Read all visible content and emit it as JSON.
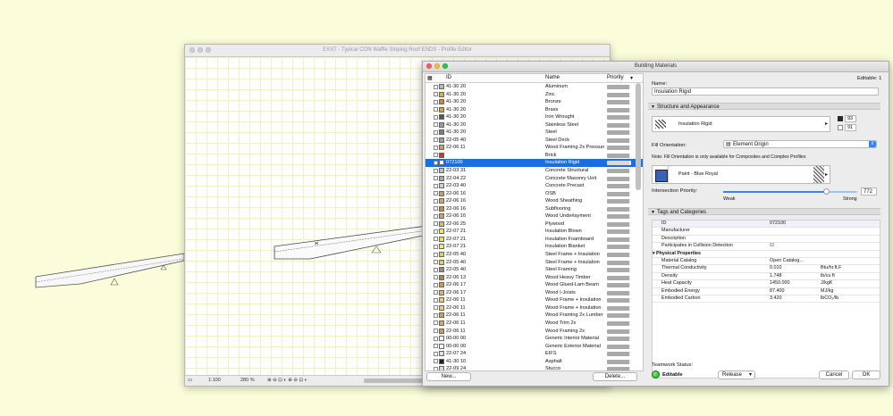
{
  "profile_editor": {
    "title": "EXST - Typical CON Waffle Sloping Roof ENDS - Profile Editor",
    "scale": "1:100",
    "zoom": "280 %"
  },
  "dialog": {
    "title": "Building Materials",
    "editable_label": "Editable: 1",
    "list_headers": {
      "id": "ID",
      "name": "Name",
      "priority": "Priority"
    },
    "rows": [
      {
        "id": "41-30 20",
        "name": "Aluminum",
        "swatch": "#b8b8b8"
      },
      {
        "id": "41-30 20",
        "name": "Zinc",
        "swatch": "#d7b24a"
      },
      {
        "id": "41-30 20",
        "name": "Bronze",
        "swatch": "#c58b3a"
      },
      {
        "id": "41-30 20",
        "name": "Brass",
        "swatch": "#e2a12b"
      },
      {
        "id": "41-30 20",
        "name": "Iron Wrought",
        "swatch": "#555555"
      },
      {
        "id": "41-30 20",
        "name": "Stainless Steel",
        "swatch": "#999999"
      },
      {
        "id": "41-30 20",
        "name": "Steel",
        "swatch": "#7d7d7d"
      },
      {
        "id": "22-05 40",
        "name": "Steel Deck",
        "swatch": "#9e9e9e"
      },
      {
        "id": "22-06 11",
        "name": "Wood Framing 2x Pressure",
        "swatch": "#c9a062"
      },
      {
        "id": "",
        "name": "Brick",
        "swatch": "#c0392b"
      },
      {
        "id": "072100",
        "name": "Insulation Rigid",
        "swatch": "#ffffff"
      },
      {
        "id": "22-03 31",
        "name": "Concrete Structural",
        "swatch": "#bdbdbd"
      },
      {
        "id": "22-04 22",
        "name": "Concrete Masonry Unit",
        "swatch": "#a5a5a5"
      },
      {
        "id": "22-03 40",
        "name": "Concrete Precast",
        "swatch": "#cfcfcf"
      },
      {
        "id": "22-06 16",
        "name": "OSB",
        "swatch": "#c7a15a"
      },
      {
        "id": "22-06 16",
        "name": "Wood Sheathing",
        "swatch": "#d1a866"
      },
      {
        "id": "22-06 16",
        "name": "Subflooring",
        "swatch": "#b88f4e"
      },
      {
        "id": "22-06 16",
        "name": "Wood Underlayment",
        "swatch": "#caa06a"
      },
      {
        "id": "22-06 25",
        "name": "Plywood",
        "swatch": "#e0b56c"
      },
      {
        "id": "22-07 21",
        "name": "Insulation Blown",
        "swatch": "#efe36a"
      },
      {
        "id": "22-07 21",
        "name": "Insulation Foamboard",
        "swatch": "#e8dc5a"
      },
      {
        "id": "22-07 21",
        "name": "Insulation Blanket",
        "swatch": "#f1e87c"
      },
      {
        "id": "22-05 40",
        "name": "Steel Frame + Insulation",
        "swatch": "#d8d25c"
      },
      {
        "id": "22-05 40",
        "name": "Steel Frame + Insulation",
        "swatch": "#d8d25c"
      },
      {
        "id": "22-05 40",
        "name": "Steel Framing",
        "swatch": "#8d8d8d"
      },
      {
        "id": "22-06 13",
        "name": "Wood Heavy Timber",
        "swatch": "#b1854a"
      },
      {
        "id": "22-06 17",
        "name": "Wood Glued-Lam Beam",
        "swatch": "#c69a58"
      },
      {
        "id": "22-06 17",
        "name": "Wood I-Joists",
        "swatch": "#d9b16e"
      },
      {
        "id": "22-06 11",
        "name": "Wood Frame + Insulation",
        "swatch": "#e5d36a"
      },
      {
        "id": "22-06 11",
        "name": "Wood Frame + Insulation",
        "swatch": "#e5d36a"
      },
      {
        "id": "22-06 11",
        "name": "Wood Framing 2x Lumber",
        "swatch": "#c99d5a"
      },
      {
        "id": "22-06 11",
        "name": "Wood Trim 2x",
        "swatch": "#d6aa66"
      },
      {
        "id": "22-06 11",
        "name": "Wood Framing 2x",
        "swatch": "#c99d5a"
      },
      {
        "id": "00-00 00",
        "name": "Generic Interior Material",
        "swatch": "#ffffff"
      },
      {
        "id": "00-00 00",
        "name": "Generic Exterior Material",
        "swatch": "#ffffff"
      },
      {
        "id": "22-07 24",
        "name": "EIFS",
        "swatch": "#dedede"
      },
      {
        "id": "41-30 10",
        "name": "Asphalt",
        "swatch": "#1e1e1e"
      },
      {
        "id": "22-09 24",
        "name": "Stucco",
        "swatch": "#d9d9d9"
      }
    ],
    "selected_index": 10,
    "new_button": "New...",
    "delete_button": "Delete...",
    "name_label": "Name:",
    "name_value": "Insulation Rigid",
    "structure_section": "Structure and Appearance",
    "fill_name": "Insulation Rigid",
    "pen_fg": "93",
    "pen_bg": "91",
    "fill_orientation_label": "Fill Orientation:",
    "fill_orientation_value": "Element Origin",
    "fill_note": "Note: Fill Orientation is only available for Composites and Complex Profiles",
    "surface_name": "Paint - Blue Royal",
    "intersection_priority_label": "Intersection Priority:",
    "intersection_priority_value": "772",
    "intersection_priority_fraction": 0.77,
    "weak_label": "Weak",
    "strong_label": "Strong",
    "tags_section": "Tags and Categories",
    "tags": [
      {
        "key": "ID",
        "value": "072100",
        "unit": "",
        "group": false,
        "first": true
      },
      {
        "key": "Manufacturer",
        "value": "",
        "unit": "",
        "group": false
      },
      {
        "key": "Description",
        "value": "",
        "unit": "",
        "group": false
      },
      {
        "key": "Participates in Collision Detection",
        "value": "☑",
        "unit": "",
        "group": false
      },
      {
        "key": "Physical Properties",
        "value": "",
        "unit": "",
        "group": true
      },
      {
        "key": "Material Catalog",
        "value": "Open Catalog...",
        "unit": "",
        "group": false
      },
      {
        "key": "Thermal Conductivity",
        "value": "0.010",
        "unit": "Btu/hr.ft.F",
        "group": false
      },
      {
        "key": "Density",
        "value": "1.748",
        "unit": "lb/cu ft",
        "group": false
      },
      {
        "key": "Heat Capacity",
        "value": "1450.000",
        "unit": "J/kgK",
        "group": false
      },
      {
        "key": "Embodied Energy",
        "value": "87.400",
        "unit": "MJ/kg",
        "group": false
      },
      {
        "key": "Embodied Carbon",
        "value": "3.420",
        "unit": "lbCO₂/lb",
        "group": false
      }
    ],
    "teamwork_label": "Teamwork Status:",
    "teamwork_status": "Editable",
    "release_label": "Release",
    "cancel_button": "Cancel",
    "ok_button": "OK"
  }
}
